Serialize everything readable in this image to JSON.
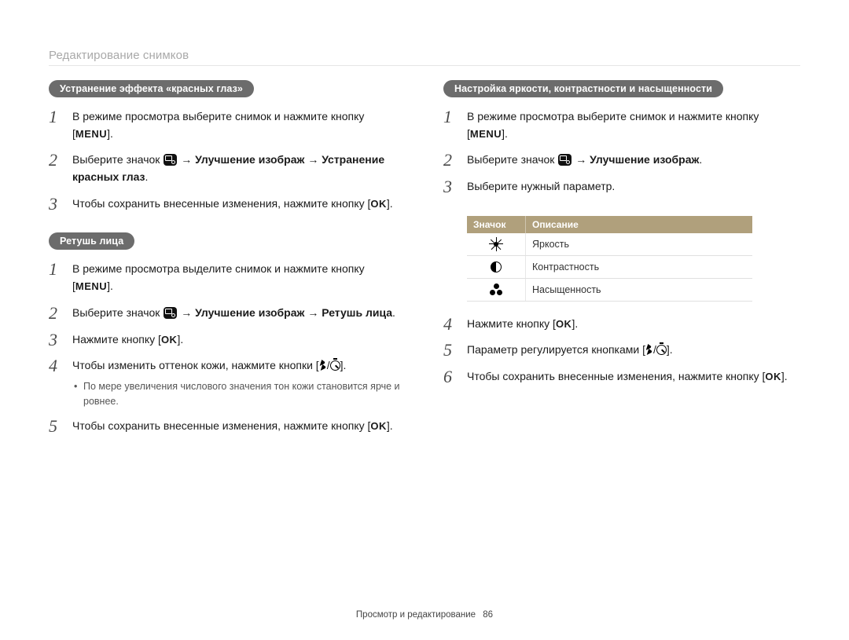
{
  "header": {
    "section_title": "Редактирование снимков"
  },
  "labels": {
    "menu": "MENU",
    "ok": "OK",
    "arrow": "→",
    "slash": "/"
  },
  "left": {
    "block1": {
      "heading": "Устранение эффекта «красных глаз»",
      "steps": [
        {
          "pre": "В режиме просмотра выберите снимок и нажмите кнопку [",
          "token": "menu",
          "post": "]."
        },
        {
          "pre": "Выберите значок ",
          "toolicon": true,
          "mid_plain": " ",
          "arrow1": true,
          "bold1": " Улучшение изображ ",
          "arrow2": true,
          "bold2": " Устранение красных глаз",
          "post": "."
        },
        {
          "pre": "Чтобы сохранить внесенные изменения, нажмите кнопку [",
          "token": "ok",
          "post": "]."
        }
      ]
    },
    "block2": {
      "heading": "Ретушь лица",
      "steps": [
        {
          "pre": "В режиме просмотра выделите снимок и нажмите кнопку [",
          "token": "menu",
          "post": "]."
        },
        {
          "pre": "Выберите значок ",
          "toolicon": true,
          "mid_plain": " ",
          "arrow1": true,
          "bold1": " Улучшение изображ ",
          "arrow2": true,
          "bold2": " Ретушь лица",
          "post": "."
        },
        {
          "pre": "Нажмите кнопку [",
          "token": "ok",
          "post": "]."
        },
        {
          "pre": "Чтобы изменить оттенок кожи, нажмите кнопки [",
          "flash_timer": true,
          "post": "].",
          "sub": "По мере увеличения числового значения тон кожи становится ярче и ровнее."
        },
        {
          "pre": "Чтобы сохранить внесенные изменения, нажмите кнопку [",
          "token": "ok",
          "post": "]."
        }
      ]
    }
  },
  "right": {
    "block1": {
      "heading": "Настройка яркости, контрастности и насыщенности",
      "steps_a": [
        {
          "pre": "В режиме просмотра выберите снимок и нажмите кнопку [",
          "token": "menu",
          "post": "]."
        },
        {
          "pre": "Выберите значок ",
          "toolicon": true,
          "mid_plain": " ",
          "arrow1": true,
          "bold1": " Улучшение изображ",
          "post": "."
        },
        {
          "pre": "Выберите нужный параметр.",
          "post": ""
        }
      ],
      "table": {
        "head_icon": "Значок",
        "head_desc": "Описание",
        "rows": [
          {
            "icon": "brightness",
            "desc": "Яркость"
          },
          {
            "icon": "contrast",
            "desc": "Контрастность"
          },
          {
            "icon": "saturation",
            "desc": "Насыщенность"
          }
        ]
      },
      "steps_b": [
        {
          "pre": "Нажмите кнопку [",
          "token": "ok",
          "post": "]."
        },
        {
          "pre": "Параметр регулируется кнопками [",
          "flash_timer": true,
          "post": "]."
        },
        {
          "pre": "Чтобы сохранить внесенные изменения, нажмите кнопку [",
          "token": "ok",
          "post": "]."
        }
      ]
    }
  },
  "footer": {
    "text": "Просмотр и редактирование",
    "page": "86"
  }
}
